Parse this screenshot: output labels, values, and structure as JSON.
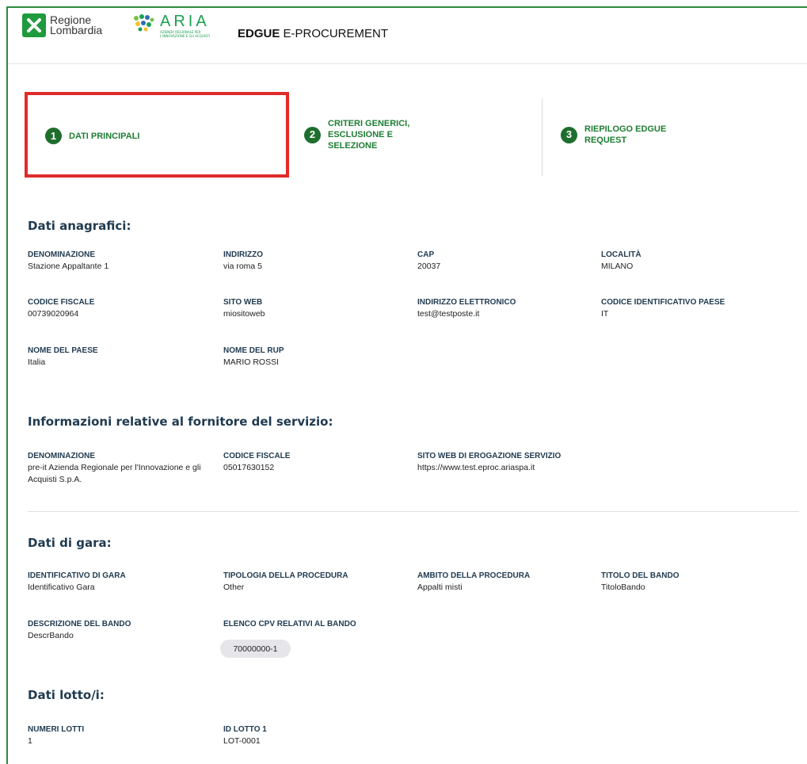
{
  "header": {
    "rl_name_line1": "Regione",
    "rl_name_line2": "Lombardia",
    "aria_word": "ARIA",
    "aria_subtitle": "AZIENDA REGIONALE PER L'INNOVAZIONE E GLI ACQUISTI",
    "app_bold": "EDGUE",
    "app_rest": " E-PROCUREMENT"
  },
  "steps": [
    {
      "num": "1",
      "label": "DATI PRINCIPALI",
      "active": true
    },
    {
      "num": "2",
      "label": "CRITERI GENERICI, ESCLUSIONE E SELEZIONE",
      "active": false
    },
    {
      "num": "3",
      "label": "RIEPILOGO EDGUE REQUEST",
      "active": false
    }
  ],
  "anagrafici": {
    "title": "Dati anagrafici:",
    "fields": [
      {
        "label": "DENOMINAZIONE",
        "value": "Stazione Appaltante 1"
      },
      {
        "label": "INDIRIZZO",
        "value": "via roma 5"
      },
      {
        "label": "CAP",
        "value": "20037"
      },
      {
        "label": "LOCALITÀ",
        "value": "MILANO"
      },
      {
        "label": "CODICE FISCALE",
        "value": "00739020964"
      },
      {
        "label": "SITO WEB",
        "value": "miositoweb"
      },
      {
        "label": "INDIRIZZO ELETTRONICO",
        "value": "test@testposte.it"
      },
      {
        "label": "CODICE IDENTIFICATIVO PAESE",
        "value": "IT"
      },
      {
        "label": "NOME DEL PAESE",
        "value": "Italia"
      },
      {
        "label": "NOME DEL RUP",
        "value": "MARIO ROSSI"
      }
    ]
  },
  "fornitore": {
    "title": "Informazioni relative al fornitore del servizio:",
    "fields": [
      {
        "label": "DENOMINAZIONE",
        "value": "pre-it Azienda Regionale per l'Innovazione e gli Acquisti S.p.A."
      },
      {
        "label": "CODICE FISCALE",
        "value": "05017630152"
      },
      {
        "label": "SITO WEB DI EROGAZIONE SERVIZIO",
        "value": "https://www.test.eproc.ariaspa.it"
      }
    ]
  },
  "gara": {
    "title": "Dati di gara:",
    "fields": [
      {
        "label": "IDENTIFICATIVO DI GARA",
        "value": "Identificativo Gara"
      },
      {
        "label": "TIPOLOGIA DELLA PROCEDURA",
        "value": "Other"
      },
      {
        "label": "AMBITO DELLA PROCEDURA",
        "value": "Appalti misti"
      },
      {
        "label": "TITOLO DEL BANDO",
        "value": "TitoloBando"
      },
      {
        "label": "DESCRIZIONE DEL BANDO",
        "value": "DescrBando"
      },
      {
        "label": "ELENCO CPV RELATIVI AL BANDO",
        "value": ""
      }
    ],
    "cpv_chip": "70000000-1"
  },
  "lotti": {
    "title": "Dati lotto/i:",
    "fields": [
      {
        "label": "NUMERI LOTTI",
        "value": "1"
      },
      {
        "label": "ID LOTTO 1",
        "value": "LOT-0001"
      }
    ]
  },
  "colors": {
    "accent_green": "#1e7d32",
    "highlight_red": "#e02b2b",
    "heading_navy": "#1f3a50"
  }
}
